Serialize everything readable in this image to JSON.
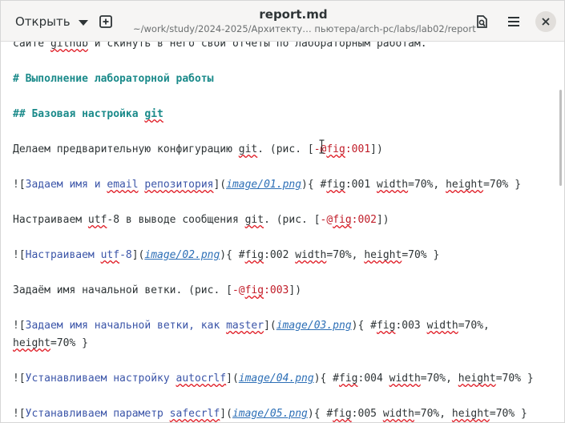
{
  "header": {
    "open_label": "Открыть",
    "title": "report.md",
    "subtitle": "~/work/study/2024-2025/Архитекту… пьютера/arch-pc/labs/lab02/report"
  },
  "icons": {
    "new_tab": "new-tab-icon",
    "save_as": "document-save-icon",
    "menu": "hamburger-menu-icon",
    "close": "close-icon"
  },
  "lines": [
    {
      "segments": [
        {
          "t": "сайте "
        },
        {
          "t": "github",
          "c": "spell"
        },
        {
          "t": " и скинуть в него свои отчеты по лабораторным работам."
        }
      ]
    },
    {
      "segments": [
        {
          "t": ""
        }
      ]
    },
    {
      "segments": [
        {
          "t": "# Выполнение лабораторной работы",
          "c": "heading"
        }
      ]
    },
    {
      "segments": [
        {
          "t": ""
        }
      ]
    },
    {
      "segments": [
        {
          "t": "## Базовая настройка ",
          "c": "heading"
        },
        {
          "t": "git",
          "c": "heading spell"
        }
      ]
    },
    {
      "segments": [
        {
          "t": ""
        }
      ]
    },
    {
      "segments": [
        {
          "t": "Делаем предварительную конфигурацию "
        },
        {
          "t": "git",
          "c": "spell"
        },
        {
          "t": ". (рис. ["
        },
        {
          "t": "-@",
          "c": "ref"
        },
        {
          "t": "fig",
          "c": "ref spell"
        },
        {
          "t": ":001",
          "c": "ref"
        },
        {
          "t": "])"
        }
      ]
    },
    {
      "segments": [
        {
          "t": ""
        }
      ]
    },
    {
      "segments": [
        {
          "t": "!["
        },
        {
          "t": "Задаем имя и ",
          "c": "link"
        },
        {
          "t": "email",
          "c": "link spell"
        },
        {
          "t": " ",
          "c": "link"
        },
        {
          "t": "репозитория",
          "c": "link spell"
        },
        {
          "t": "]("
        },
        {
          "t": "image/01.png",
          "c": "url"
        },
        {
          "t": "){ #"
        },
        {
          "t": "fig",
          "c": "spell"
        },
        {
          "t": ":001 "
        },
        {
          "t": "width",
          "c": "spell"
        },
        {
          "t": "=70%, "
        },
        {
          "t": "height",
          "c": "spell"
        },
        {
          "t": "=70% }"
        }
      ]
    },
    {
      "segments": [
        {
          "t": ""
        }
      ]
    },
    {
      "segments": [
        {
          "t": "Настраиваем "
        },
        {
          "t": "utf",
          "c": "spell"
        },
        {
          "t": "-8 в выводе сообщения "
        },
        {
          "t": "git",
          "c": "spell"
        },
        {
          "t": ". (рис. ["
        },
        {
          "t": "-@",
          "c": "ref"
        },
        {
          "t": "fig",
          "c": "ref spell"
        },
        {
          "t": ":002",
          "c": "ref"
        },
        {
          "t": "])"
        }
      ]
    },
    {
      "segments": [
        {
          "t": ""
        }
      ]
    },
    {
      "segments": [
        {
          "t": "!["
        },
        {
          "t": "Настраиваем ",
          "c": "link"
        },
        {
          "t": "utf",
          "c": "link spell"
        },
        {
          "t": "-8",
          "c": "link"
        },
        {
          "t": "]("
        },
        {
          "t": "image/02.png",
          "c": "url"
        },
        {
          "t": "){ #"
        },
        {
          "t": "fig",
          "c": "spell"
        },
        {
          "t": ":002 "
        },
        {
          "t": "width",
          "c": "spell"
        },
        {
          "t": "=70%, "
        },
        {
          "t": "height",
          "c": "spell"
        },
        {
          "t": "=70% }"
        }
      ]
    },
    {
      "segments": [
        {
          "t": ""
        }
      ]
    },
    {
      "segments": [
        {
          "t": "Задаём имя начальной ветки. (рис. ["
        },
        {
          "t": "-@",
          "c": "ref"
        },
        {
          "t": "fig",
          "c": "ref spell"
        },
        {
          "t": ":003",
          "c": "ref"
        },
        {
          "t": "])"
        }
      ]
    },
    {
      "segments": [
        {
          "t": ""
        }
      ]
    },
    {
      "segments": [
        {
          "t": "!["
        },
        {
          "t": "Задаем имя начальной ветки, как ",
          "c": "link"
        },
        {
          "t": "master",
          "c": "link spell"
        },
        {
          "t": "]("
        },
        {
          "t": "image/03.png",
          "c": "url"
        },
        {
          "t": "){ #"
        },
        {
          "t": "fig",
          "c": "spell"
        },
        {
          "t": ":003 "
        },
        {
          "t": "width",
          "c": "spell"
        },
        {
          "t": "=70%,"
        }
      ]
    },
    {
      "segments": [
        {
          "t": "height",
          "c": "spell"
        },
        {
          "t": "=70% }"
        }
      ]
    },
    {
      "segments": [
        {
          "t": ""
        }
      ]
    },
    {
      "segments": [
        {
          "t": "!["
        },
        {
          "t": "Устанавливаем настройку ",
          "c": "link"
        },
        {
          "t": "autocrlf",
          "c": "link spell"
        },
        {
          "t": "]("
        },
        {
          "t": "image/04.png",
          "c": "url"
        },
        {
          "t": "){ #"
        },
        {
          "t": "fig",
          "c": "spell"
        },
        {
          "t": ":004 "
        },
        {
          "t": "width",
          "c": "spell"
        },
        {
          "t": "=70%, "
        },
        {
          "t": "height",
          "c": "spell"
        },
        {
          "t": "=70% }"
        }
      ]
    },
    {
      "segments": [
        {
          "t": ""
        }
      ]
    },
    {
      "segments": [
        {
          "t": "!["
        },
        {
          "t": "Устанавливаем параметр ",
          "c": "link"
        },
        {
          "t": "safecrlf",
          "c": "link spell"
        },
        {
          "t": "]("
        },
        {
          "t": "image/05.png",
          "c": "url"
        },
        {
          "t": "){ #"
        },
        {
          "t": "fig",
          "c": "spell"
        },
        {
          "t": ":005 "
        },
        {
          "t": "width",
          "c": "spell"
        },
        {
          "t": "=70%, "
        },
        {
          "t": "height",
          "c": "spell"
        },
        {
          "t": "=70% }"
        }
      ]
    }
  ]
}
